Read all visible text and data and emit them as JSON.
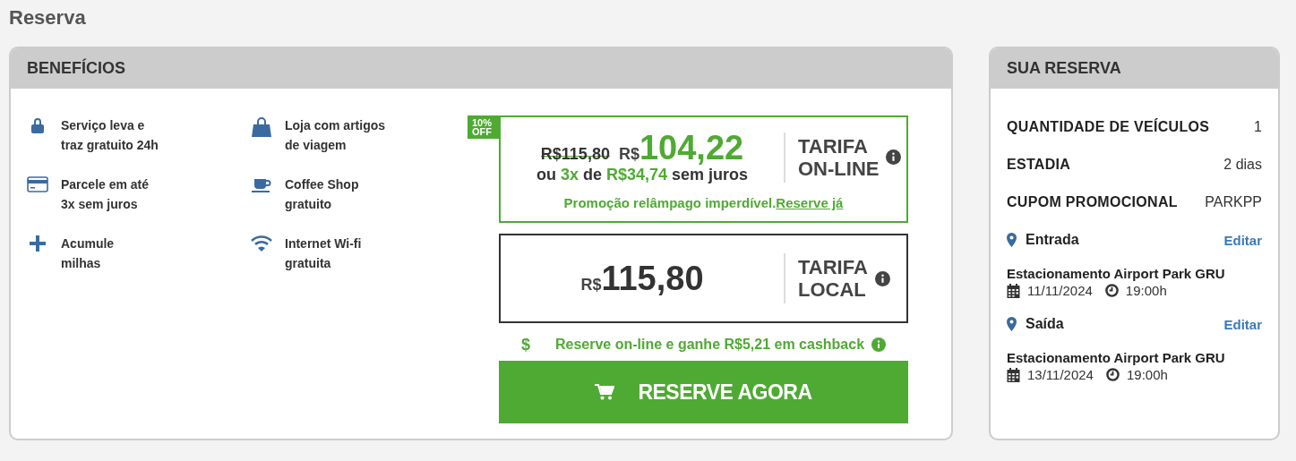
{
  "page_title": "Reserva",
  "benefits": {
    "title": "BENEFÍCIOS",
    "items": [
      {
        "kind": "lock",
        "lines": [
          "Serviço leva e",
          "traz gratuito 24h"
        ]
      },
      {
        "kind": "bag",
        "lines": [
          "Loja com artigos",
          "de viagem"
        ]
      },
      {
        "kind": "card",
        "lines": [
          "Parcele em até",
          "3x sem juros"
        ]
      },
      {
        "kind": "cup",
        "lines": [
          "Coffee Shop",
          "gratuito"
        ]
      },
      {
        "kind": "plus",
        "lines": [
          "Acumule",
          "milhas"
        ]
      },
      {
        "kind": "wifi",
        "lines": [
          "Internet Wi-fi",
          "gratuita"
        ]
      }
    ]
  },
  "online_fare": {
    "badge": [
      "10%",
      "OFF"
    ],
    "old_price": "R$115,80",
    "currency": "R$",
    "price": "104,22",
    "installments": [
      {
        "text": "ou ",
        "highlight": false
      },
      {
        "text": "3x",
        "highlight": true
      },
      {
        "text": " de ",
        "highlight": false
      },
      {
        "text": "R$34,74",
        "highlight": true
      },
      {
        "text": " sem juros",
        "highlight": false
      }
    ],
    "label": [
      "TARIFA",
      "ON-LINE"
    ],
    "promo": "Promoção relâmpago imperdível.",
    "promo_link": "Reserve já"
  },
  "local_fare": {
    "currency": "R$",
    "price": "115,80",
    "label": [
      "TARIFA",
      "LOCAL"
    ]
  },
  "cashback": {
    "icon": "$",
    "text": "Reserve on-line e ganhe R$5,21 em cashback"
  },
  "reserve_button": "RESERVE AGORA",
  "summary": {
    "title": "SUA RESERVA",
    "rows": [
      {
        "label": "QUANTIDADE DE VEÍCULOS",
        "value": "1"
      },
      {
        "label": "ESTADIA",
        "value": "2 dias"
      },
      {
        "label": "CUPOM PROMOCIONAL",
        "value": "PARKPP"
      }
    ],
    "stops": [
      {
        "label": "Entrada",
        "edit": "Editar",
        "place": "Estacionamento Airport Park GRU",
        "date": "11/11/2024",
        "time": "19:00h"
      },
      {
        "label": "Saída",
        "edit": "Editar",
        "place": "Estacionamento Airport Park GRU",
        "date": "13/11/2024",
        "time": "19:00h"
      }
    ]
  }
}
